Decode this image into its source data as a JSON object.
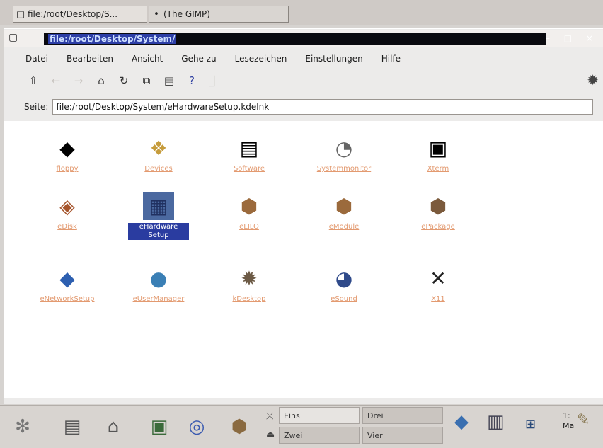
{
  "tabs": [
    {
      "label": "file:/root/Desktop/S..."
    },
    {
      "label": "(The GIMP)"
    }
  ],
  "window": {
    "title": "file:/root/Desktop/System/"
  },
  "menu": [
    "Datei",
    "Bearbeiten",
    "Ansicht",
    "Gehe zu",
    "Lesezeichen",
    "Einstellungen",
    "Hilfe"
  ],
  "location": {
    "label": "Seite:",
    "value": "file:/root/Desktop/System/eHardwareSetup.kdelnk"
  },
  "icons": [
    {
      "label": "floppy",
      "icon": "floppy-icon",
      "glyph": "◆"
    },
    {
      "label": "Devices",
      "icon": "devices-icon",
      "glyph": "❖"
    },
    {
      "label": "Software",
      "icon": "software-icon",
      "glyph": "▤"
    },
    {
      "label": "Systemmonitor",
      "icon": "monitor-icon",
      "glyph": "◔"
    },
    {
      "label": "Xterm",
      "icon": "terminal-icon",
      "glyph": "▣"
    },
    {
      "label": "eDisk",
      "icon": "disk-icon",
      "glyph": "◈"
    },
    {
      "label": "eHardware Setup",
      "icon": "hardware-setup-icon",
      "glyph": "▦",
      "selected": true
    },
    {
      "label": "eLILO",
      "icon": "package-icon",
      "glyph": "⬢"
    },
    {
      "label": "eModule",
      "icon": "package-icon",
      "glyph": "⬢"
    },
    {
      "label": "ePackage",
      "icon": "package-tool-icon",
      "glyph": "⬢"
    },
    {
      "label": "eNetworkSetup",
      "icon": "network-icon",
      "glyph": "◆"
    },
    {
      "label": "eUserManager",
      "icon": "users-icon",
      "glyph": "●"
    },
    {
      "label": "kDesktop",
      "icon": "gear-icon",
      "glyph": "✹"
    },
    {
      "label": "eSound",
      "icon": "sound-icon",
      "glyph": "◕"
    },
    {
      "label": "X11",
      "icon": "x-icon",
      "glyph": "✕"
    }
  ],
  "pager": [
    "Eins",
    "Drei",
    "Zwei",
    "Vier"
  ],
  "clock": [
    "1:",
    "Ma"
  ],
  "colors": {
    "title_bar": "#0a0a0f",
    "selection": "#2a3ca0",
    "icon_label": "#e39a70"
  }
}
